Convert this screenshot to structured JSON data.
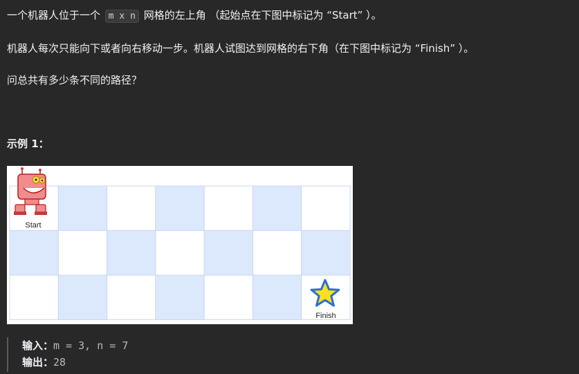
{
  "description": {
    "line1_before": "一个机器人位于一个 ",
    "line1_code": "m x n",
    "line1_after": " 网格的左上角 （起始点在下图中标记为 “Start” ）。",
    "line2": "机器人每次只能向下或者向右移动一步。机器人试图达到网格的右下角（在下图中标记为 “Finish” ）。",
    "line3": "问总共有多少条不同的路径？"
  },
  "example": {
    "title": "示例 1：",
    "figure": {
      "rows": 3,
      "cols": 7,
      "start_label": "Start",
      "finish_label": "Finish",
      "start_icon": "robot-icon",
      "finish_icon": "star-icon",
      "cell_colors": {
        "light": "#dce8fc",
        "white": "#ffffff",
        "border": "#c9d7f0"
      },
      "star_color": "#ffe11a",
      "star_outline": "#2a6fd6",
      "robot_color": "#f28b8b"
    },
    "input_label": "输入：",
    "input_value": "m = 3, n = 7",
    "output_label": "输出：",
    "output_value": "28"
  },
  "colors": {
    "background": "#282828",
    "text": "#eff1f6",
    "muted": "#b9b9b9"
  }
}
